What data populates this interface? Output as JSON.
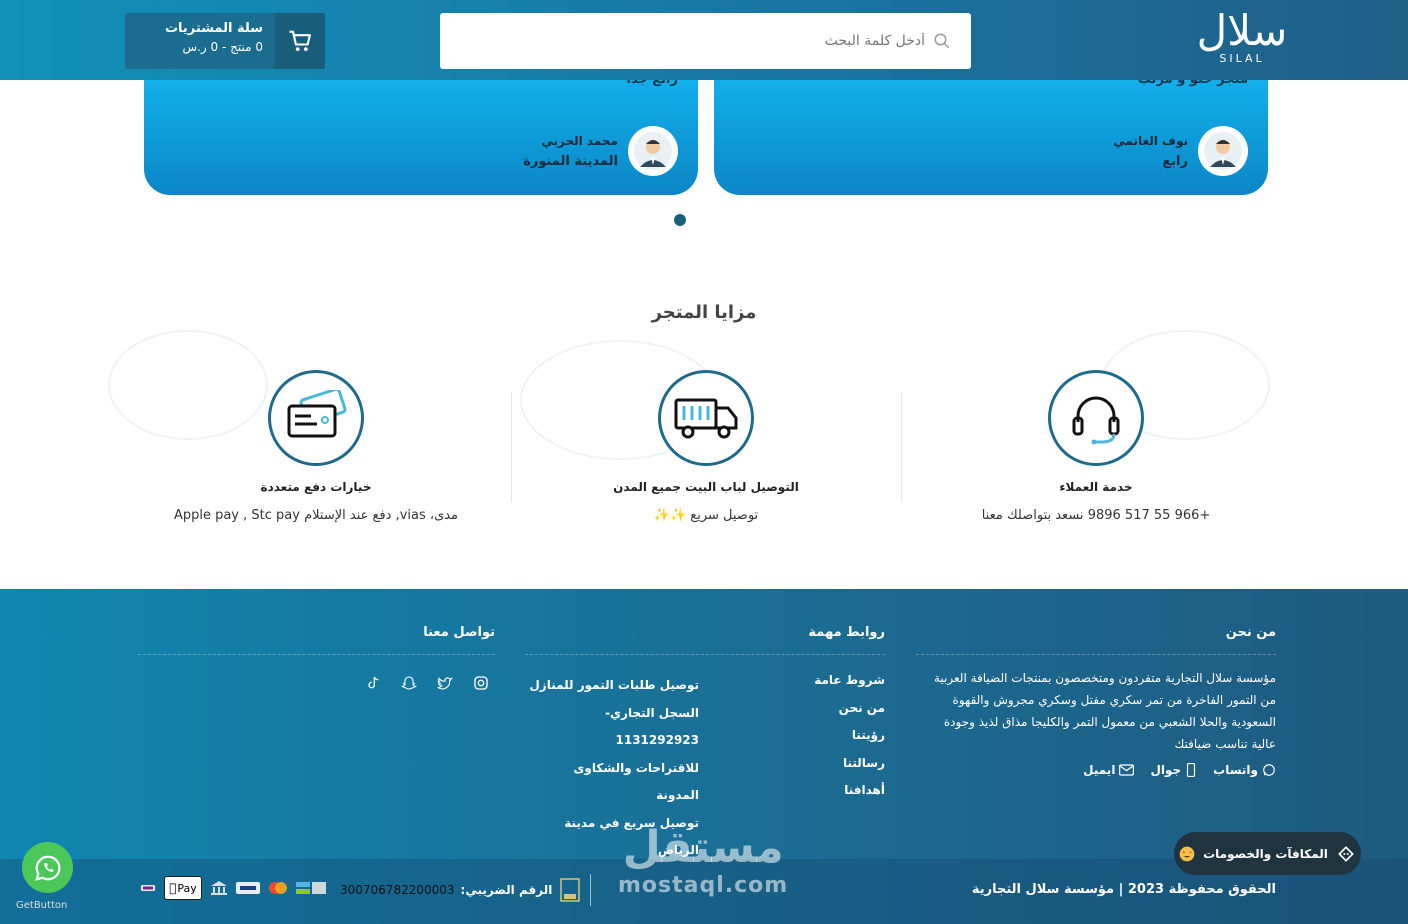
{
  "header": {
    "logo_ar": "سلال",
    "logo_en": "SILAL",
    "search_placeholder": "أدخل كلمة البحث",
    "cart_title": "سلة المشتريات",
    "cart_summary": "0 منتج - 0 ر.س"
  },
  "testimonials": [
    {
      "quote": "متجر حلو و مرتب",
      "name": "نوف الغانمي",
      "city": "رابع"
    },
    {
      "quote": "رائع جدا",
      "name": "محمد الحربي",
      "city": "المدينة المنورة"
    }
  ],
  "features": {
    "title": "مزايا المتجر",
    "items": [
      {
        "name": "خدمة العملاء",
        "desc": "+966 55 517 9896 نسعد بتواصلك معنا",
        "icon": "headset-icon"
      },
      {
        "name": "التوصيل لباب البيت جميع المدن",
        "desc": "توصيل سريع ✨✨",
        "icon": "delivery-truck-icon"
      },
      {
        "name": "خيارات دفع متعددة",
        "desc": "مدى، vias, دفع عند الإستلام Apple pay , Stc pay",
        "icon": "credit-card-icon"
      }
    ]
  },
  "footer": {
    "about_title": "من نحن",
    "about_text": "مؤسسة سلال التجارية متفردون ومتخصصون بمنتجات الضيافة العربية من التمور الفاخرة من تمر سكري مفتل وسكري مجروش والقهوة السعودية والحلا الشعبي من معمول التمر والكليجا مذاق لذيذ وجودة عالية تناسب ضيافتك",
    "contact_whatsapp": "واتساب",
    "contact_mobile": "جوال",
    "contact_email": "ايميل",
    "links_title": "روابط مهمة",
    "links_col1": [
      "شروط عامة",
      "من نحن",
      "رؤيتنا",
      "رسالتنا",
      "أهدافنا"
    ],
    "links_col2": [
      "توصيل طلبات التمور للمنازل",
      "السجل التجاري- 1131292923",
      "للاقتراحات والشكاوى",
      "المدونة",
      "توصيل سريع في مدينة الرياض"
    ],
    "contact_title": "تواصل معنا",
    "copyright": "الحقوق محفوظة  2023 | مؤسسة سلال التجارية",
    "tax_label": "الرقم الضريبي:",
    "tax_number": "300706782200003",
    "apple_pay": "Pay",
    "rewards_label": "المكافآت والخصومات",
    "watermark_ar": "مستقل",
    "watermark_en": "mostaql.com",
    "getbutton": "GetButton"
  },
  "colors": {
    "header_start": "#1290b8",
    "header_end": "#1f5f86",
    "card_blue": "#14b6f0",
    "icon_ring": "#1e6a8a",
    "whatsapp": "#4cc75a"
  }
}
